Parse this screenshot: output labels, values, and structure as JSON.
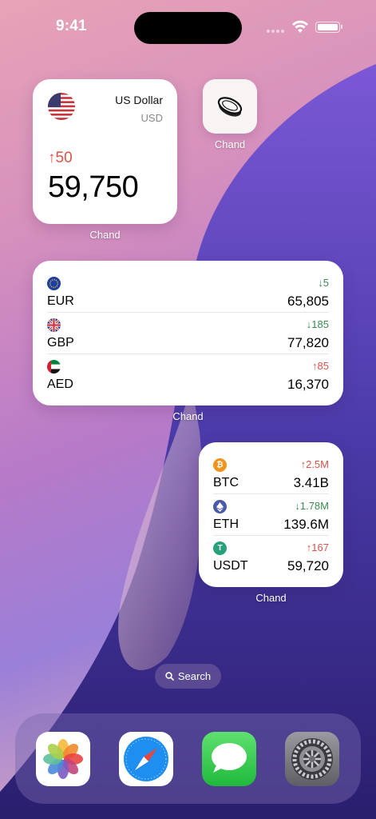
{
  "status_bar": {
    "time": "9:41"
  },
  "usd_widget": {
    "name": "US Dollar",
    "code": "USD",
    "change": "↑50",
    "value": "59,750",
    "app_label": "Chand"
  },
  "coin_app": {
    "icon": "coin-icon",
    "label": "Chand"
  },
  "fiat_widget": {
    "app_label": "Chand",
    "rows": [
      {
        "code": "EUR",
        "change": "↓5",
        "direction": "down",
        "value": "65,805",
        "icon": "eu-flag-icon"
      },
      {
        "code": "GBP",
        "change": "↓185",
        "direction": "down",
        "value": "77,820",
        "icon": "uk-flag-icon"
      },
      {
        "code": "AED",
        "change": "↑85",
        "direction": "up",
        "value": "16,370",
        "icon": "uae-flag-icon"
      }
    ]
  },
  "crypto_widget": {
    "app_label": "Chand",
    "rows": [
      {
        "code": "BTC",
        "change": "↑2.5M",
        "direction": "up",
        "value": "3.41B",
        "icon": "bitcoin-icon",
        "color": "#f2931c"
      },
      {
        "code": "ETH",
        "change": "↓1.78M",
        "direction": "down",
        "value": "139.6M",
        "icon": "ethereum-icon",
        "color": "#4a5aa8"
      },
      {
        "code": "USDT",
        "change": "↑167",
        "direction": "up",
        "value": "59,720",
        "icon": "tether-icon",
        "color": "#26a17b"
      }
    ]
  },
  "search": {
    "label": "Search"
  },
  "dock": {
    "apps": [
      "photos-icon",
      "safari-icon",
      "messages-icon",
      "settings-icon"
    ]
  },
  "colors": {
    "up": "#d9534a",
    "down": "#3a8a52"
  }
}
